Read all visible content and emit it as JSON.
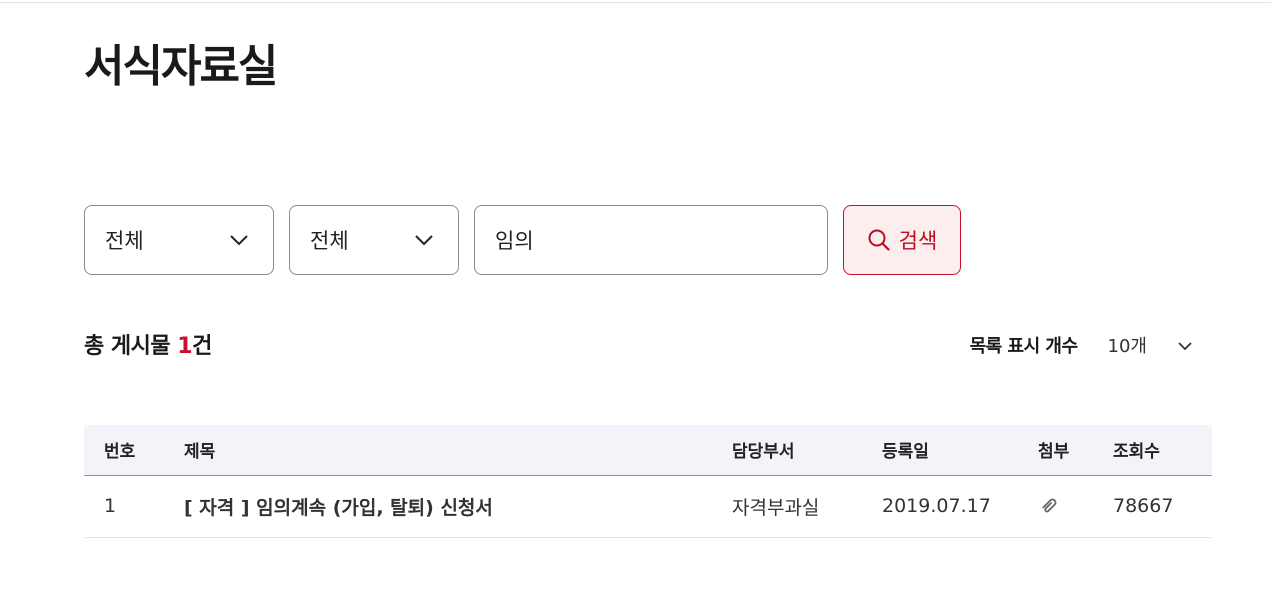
{
  "page": {
    "title": "서식자료실"
  },
  "search": {
    "category_select": "전체",
    "field_select": "전체",
    "keyword_value": "임의",
    "button_label": "검색"
  },
  "summary": {
    "prefix": "총 게시물 ",
    "count": "1",
    "suffix": "건"
  },
  "page_size": {
    "label": "목록 표시 개수",
    "value": "10개"
  },
  "table": {
    "columns": [
      "번호",
      "제목",
      "담당부서",
      "등록일",
      "첨부",
      "조회수"
    ],
    "rows": [
      {
        "no": "1",
        "title": "[ 자격 ] 임의계속 (가입, 탈퇴) 신청서",
        "dept": "자격부과실",
        "date": "2019.07.17",
        "attachment_icon": "paperclip-icon",
        "views": "78667"
      }
    ]
  },
  "colors": {
    "accent": "#c8102e",
    "search_button_bg": "#fdeeee",
    "table_header_bg": "#f3f4f9"
  }
}
